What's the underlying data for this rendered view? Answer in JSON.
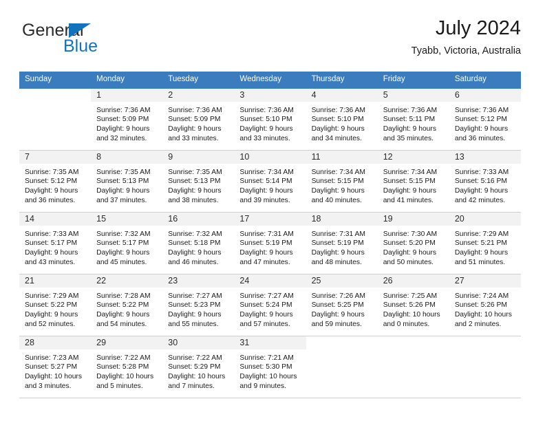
{
  "brand": {
    "name_part1": "General",
    "name_part2": "Blue",
    "triangle_color": "#1272bb"
  },
  "header": {
    "title": "July 2024",
    "subtitle": "Tyabb, Victoria, Australia"
  },
  "theme": {
    "header_bg": "#3a7cbe",
    "daynum_band_bg": "#f2f2f2",
    "grid_line": "#cfcfcf"
  },
  "weekdays": [
    "Sunday",
    "Monday",
    "Tuesday",
    "Wednesday",
    "Thursday",
    "Friday",
    "Saturday"
  ],
  "weeks": [
    [
      {
        "empty": true
      },
      {
        "day": "1",
        "sunrise": "Sunrise: 7:36 AM",
        "sunset": "Sunset: 5:09 PM",
        "daylight1": "Daylight: 9 hours",
        "daylight2": "and 32 minutes."
      },
      {
        "day": "2",
        "sunrise": "Sunrise: 7:36 AM",
        "sunset": "Sunset: 5:09 PM",
        "daylight1": "Daylight: 9 hours",
        "daylight2": "and 33 minutes."
      },
      {
        "day": "3",
        "sunrise": "Sunrise: 7:36 AM",
        "sunset": "Sunset: 5:10 PM",
        "daylight1": "Daylight: 9 hours",
        "daylight2": "and 33 minutes."
      },
      {
        "day": "4",
        "sunrise": "Sunrise: 7:36 AM",
        "sunset": "Sunset: 5:10 PM",
        "daylight1": "Daylight: 9 hours",
        "daylight2": "and 34 minutes."
      },
      {
        "day": "5",
        "sunrise": "Sunrise: 7:36 AM",
        "sunset": "Sunset: 5:11 PM",
        "daylight1": "Daylight: 9 hours",
        "daylight2": "and 35 minutes."
      },
      {
        "day": "6",
        "sunrise": "Sunrise: 7:36 AM",
        "sunset": "Sunset: 5:12 PM",
        "daylight1": "Daylight: 9 hours",
        "daylight2": "and 36 minutes."
      }
    ],
    [
      {
        "day": "7",
        "sunrise": "Sunrise: 7:35 AM",
        "sunset": "Sunset: 5:12 PM",
        "daylight1": "Daylight: 9 hours",
        "daylight2": "and 36 minutes."
      },
      {
        "day": "8",
        "sunrise": "Sunrise: 7:35 AM",
        "sunset": "Sunset: 5:13 PM",
        "daylight1": "Daylight: 9 hours",
        "daylight2": "and 37 minutes."
      },
      {
        "day": "9",
        "sunrise": "Sunrise: 7:35 AM",
        "sunset": "Sunset: 5:13 PM",
        "daylight1": "Daylight: 9 hours",
        "daylight2": "and 38 minutes."
      },
      {
        "day": "10",
        "sunrise": "Sunrise: 7:34 AM",
        "sunset": "Sunset: 5:14 PM",
        "daylight1": "Daylight: 9 hours",
        "daylight2": "and 39 minutes."
      },
      {
        "day": "11",
        "sunrise": "Sunrise: 7:34 AM",
        "sunset": "Sunset: 5:15 PM",
        "daylight1": "Daylight: 9 hours",
        "daylight2": "and 40 minutes."
      },
      {
        "day": "12",
        "sunrise": "Sunrise: 7:34 AM",
        "sunset": "Sunset: 5:15 PM",
        "daylight1": "Daylight: 9 hours",
        "daylight2": "and 41 minutes."
      },
      {
        "day": "13",
        "sunrise": "Sunrise: 7:33 AM",
        "sunset": "Sunset: 5:16 PM",
        "daylight1": "Daylight: 9 hours",
        "daylight2": "and 42 minutes."
      }
    ],
    [
      {
        "day": "14",
        "sunrise": "Sunrise: 7:33 AM",
        "sunset": "Sunset: 5:17 PM",
        "daylight1": "Daylight: 9 hours",
        "daylight2": "and 43 minutes."
      },
      {
        "day": "15",
        "sunrise": "Sunrise: 7:32 AM",
        "sunset": "Sunset: 5:17 PM",
        "daylight1": "Daylight: 9 hours",
        "daylight2": "and 45 minutes."
      },
      {
        "day": "16",
        "sunrise": "Sunrise: 7:32 AM",
        "sunset": "Sunset: 5:18 PM",
        "daylight1": "Daylight: 9 hours",
        "daylight2": "and 46 minutes."
      },
      {
        "day": "17",
        "sunrise": "Sunrise: 7:31 AM",
        "sunset": "Sunset: 5:19 PM",
        "daylight1": "Daylight: 9 hours",
        "daylight2": "and 47 minutes."
      },
      {
        "day": "18",
        "sunrise": "Sunrise: 7:31 AM",
        "sunset": "Sunset: 5:19 PM",
        "daylight1": "Daylight: 9 hours",
        "daylight2": "and 48 minutes."
      },
      {
        "day": "19",
        "sunrise": "Sunrise: 7:30 AM",
        "sunset": "Sunset: 5:20 PM",
        "daylight1": "Daylight: 9 hours",
        "daylight2": "and 50 minutes."
      },
      {
        "day": "20",
        "sunrise": "Sunrise: 7:29 AM",
        "sunset": "Sunset: 5:21 PM",
        "daylight1": "Daylight: 9 hours",
        "daylight2": "and 51 minutes."
      }
    ],
    [
      {
        "day": "21",
        "sunrise": "Sunrise: 7:29 AM",
        "sunset": "Sunset: 5:22 PM",
        "daylight1": "Daylight: 9 hours",
        "daylight2": "and 52 minutes."
      },
      {
        "day": "22",
        "sunrise": "Sunrise: 7:28 AM",
        "sunset": "Sunset: 5:22 PM",
        "daylight1": "Daylight: 9 hours",
        "daylight2": "and 54 minutes."
      },
      {
        "day": "23",
        "sunrise": "Sunrise: 7:27 AM",
        "sunset": "Sunset: 5:23 PM",
        "daylight1": "Daylight: 9 hours",
        "daylight2": "and 55 minutes."
      },
      {
        "day": "24",
        "sunrise": "Sunrise: 7:27 AM",
        "sunset": "Sunset: 5:24 PM",
        "daylight1": "Daylight: 9 hours",
        "daylight2": "and 57 minutes."
      },
      {
        "day": "25",
        "sunrise": "Sunrise: 7:26 AM",
        "sunset": "Sunset: 5:25 PM",
        "daylight1": "Daylight: 9 hours",
        "daylight2": "and 59 minutes."
      },
      {
        "day": "26",
        "sunrise": "Sunrise: 7:25 AM",
        "sunset": "Sunset: 5:26 PM",
        "daylight1": "Daylight: 10 hours",
        "daylight2": "and 0 minutes."
      },
      {
        "day": "27",
        "sunrise": "Sunrise: 7:24 AM",
        "sunset": "Sunset: 5:26 PM",
        "daylight1": "Daylight: 10 hours",
        "daylight2": "and 2 minutes."
      }
    ],
    [
      {
        "day": "28",
        "sunrise": "Sunrise: 7:23 AM",
        "sunset": "Sunset: 5:27 PM",
        "daylight1": "Daylight: 10 hours",
        "daylight2": "and 3 minutes."
      },
      {
        "day": "29",
        "sunrise": "Sunrise: 7:22 AM",
        "sunset": "Sunset: 5:28 PM",
        "daylight1": "Daylight: 10 hours",
        "daylight2": "and 5 minutes."
      },
      {
        "day": "30",
        "sunrise": "Sunrise: 7:22 AM",
        "sunset": "Sunset: 5:29 PM",
        "daylight1": "Daylight: 10 hours",
        "daylight2": "and 7 minutes."
      },
      {
        "day": "31",
        "sunrise": "Sunrise: 7:21 AM",
        "sunset": "Sunset: 5:30 PM",
        "daylight1": "Daylight: 10 hours",
        "daylight2": "and 9 minutes."
      },
      {
        "empty": true
      },
      {
        "empty": true
      },
      {
        "empty": true
      }
    ]
  ]
}
